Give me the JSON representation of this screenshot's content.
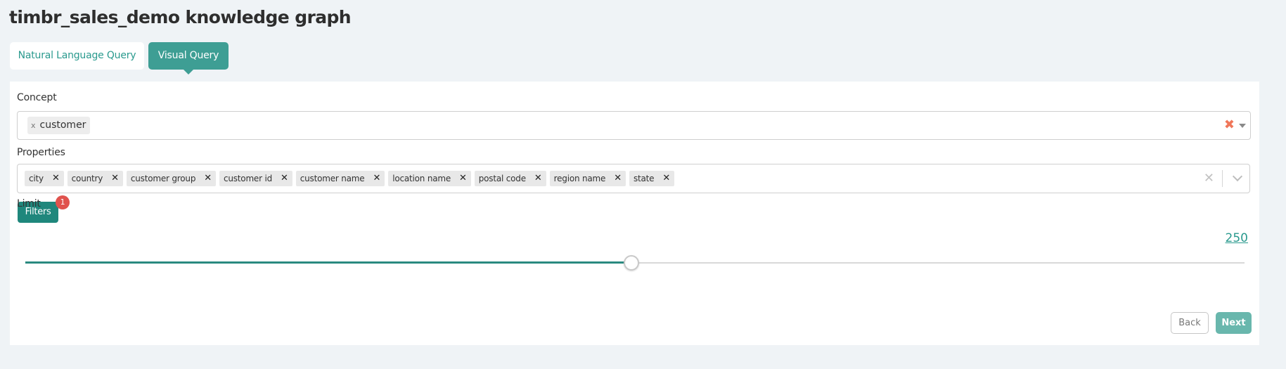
{
  "page_title": "timbr_sales_demo knowledge graph",
  "tabs": [
    {
      "label": "Natural Language Query",
      "active": false
    },
    {
      "label": "Visual Query",
      "active": true
    }
  ],
  "concept": {
    "label": "Concept",
    "chip_remove": "x",
    "selected": "customer",
    "clear_icon": "✖"
  },
  "properties": {
    "label": "Properties",
    "items": [
      "city",
      "country",
      "customer group",
      "customer id",
      "customer name",
      "location name",
      "postal code",
      "region name",
      "state"
    ],
    "remove_icon": "✕",
    "clear_icon": "✕"
  },
  "filters": {
    "label": "Filters",
    "count": "1"
  },
  "limit": {
    "label": "Limit",
    "value": "250",
    "fraction": 0.497
  },
  "actions": {
    "back_label": "Back",
    "next_label": "Next"
  },
  "colors": {
    "accent": "#3e9e94",
    "filters_button": "#1f877c",
    "badge": "#e0524d",
    "clear_concept": "#f0775a",
    "next_button": "#69b7ad"
  }
}
